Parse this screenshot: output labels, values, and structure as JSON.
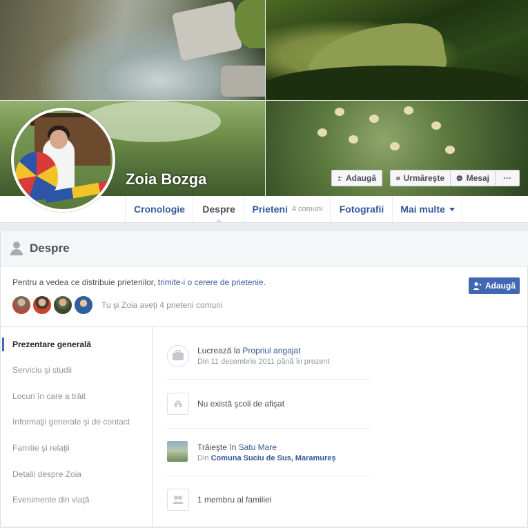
{
  "profile": {
    "name": "Zoia Bozga"
  },
  "cover_actions": {
    "add_friend_label": "Adaugă",
    "follow_label": "Urmăreşte",
    "message_label": "Mesaj",
    "more_label": "···"
  },
  "nav": {
    "timeline": "Cronologie",
    "about": "Despre",
    "friends": "Prieteni",
    "friends_count": "4 comuni",
    "photos": "Fotografii",
    "more": "Mai multe"
  },
  "about": {
    "title": "Despre",
    "notice_prefix": "Pentru a vedea ce distribuie prietenilor, ",
    "notice_link": "trimite-i o cerere de prietenie",
    "notice_suffix": ".",
    "add_button": "Adaugă",
    "mutual_text": "Tu şi Zoia aveţi 4 prieteni comuni"
  },
  "sidebar": {
    "items": [
      {
        "label": "Prezentare generală",
        "active": true
      },
      {
        "label": "Serviciu şi studii",
        "active": false
      },
      {
        "label": "Locuri în care a trăit",
        "active": false
      },
      {
        "label": "Informaţii generale şi de contact",
        "active": false
      },
      {
        "label": "Familie şi relaţii",
        "active": false
      },
      {
        "label": "Detalii despre Zoia",
        "active": false
      },
      {
        "label": "Evenimente din viaţă",
        "active": false
      }
    ]
  },
  "overview": {
    "work_prefix": "Lucrează la ",
    "work_link": "Propriul angajat",
    "work_since": "Din 11 decembrie 2011 până în prezent",
    "school": "Nu există şcoli de afişat",
    "lives_prefix": "Trăieşte în ",
    "lives_link": "Satu Mare",
    "from_prefix": "Din ",
    "from_link": "Comuna Suciu de Sus, Maramureș",
    "family": "1 membru al familiei"
  },
  "colors": {
    "link": "#365899",
    "primary_button": "#4267b2",
    "page_bg": "#e9ebee"
  }
}
